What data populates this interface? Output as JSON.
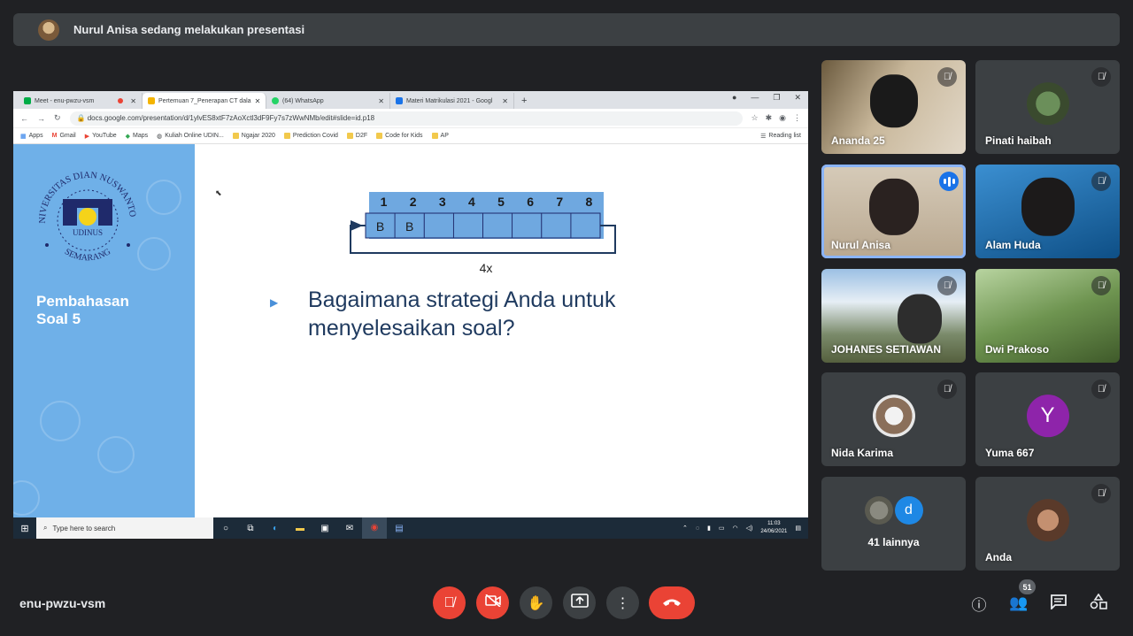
{
  "banner": {
    "text": "Nurul Anisa sedang melakukan presentasi"
  },
  "browser": {
    "tabs": [
      {
        "label": "Meet - enu-pwzu-vsm",
        "color": "#00ac47",
        "active": false
      },
      {
        "label": "Pertemuan 7_Penerapan CT dala",
        "color": "#f4b400",
        "active": true
      },
      {
        "label": "(64) WhatsApp",
        "color": "#25d366",
        "active": false
      },
      {
        "label": "Materi Matrikulasi 2021 - Googl",
        "color": "#1a73e8",
        "active": false
      }
    ],
    "new_tab": "+",
    "url": "docs.google.com/presentation/d/1ylvES8xtF7zAoXctl3dF9Fy7s7zWwNMb/edit#slide=id.p18",
    "bookmarks": [
      "Apps",
      "Gmail",
      "YouTube",
      "Maps",
      "Kuliah Online UDIN...",
      "Ngajar 2020",
      "Prediction Covid",
      "D2F",
      "Code for Kids",
      "AP"
    ],
    "reading_list": "Reading list"
  },
  "slide": {
    "logo_top": "UNIVERSITAS DIAN NUSWANTORO",
    "logo_bottom": "SEMARANG",
    "logo_word": "UDINUS",
    "side_title_line1": "Pembahasan",
    "side_title_line2": "Soal 5",
    "diagram_numbers": [
      "1",
      "2",
      "3",
      "4",
      "5",
      "6",
      "7",
      "8"
    ],
    "diagram_cells": [
      "B",
      "B",
      "",
      "",
      "",
      "",
      "",
      ""
    ],
    "loop_label": "4x",
    "question_line1": "Bagaimana strategi Anda untuk",
    "question_line2": "menyelesaikan soal?"
  },
  "taskbar": {
    "search_placeholder": "Type here to search",
    "time": "11:03",
    "date": "24/06/2021"
  },
  "participants": [
    {
      "name": "Ananda 25",
      "muted": true,
      "bg": "#b9a58c"
    },
    {
      "name": "Pinati haibah",
      "muted": true,
      "bg": "#3c4043"
    },
    {
      "name": "Nurul Anisa",
      "muted": false,
      "bg": "#cbbfae"
    },
    {
      "name": "Alam Huda",
      "muted": true,
      "bg": "#1d6fb0"
    },
    {
      "name": "JOHANES SETIAWAN",
      "muted": true,
      "bg": "#8fb1cf"
    },
    {
      "name": "Dwi Prakoso",
      "muted": true,
      "bg": "#7a9a5a"
    },
    {
      "name": "Nida Karima",
      "muted": true,
      "bg": "#3c4043"
    },
    {
      "name": "Yuma 667",
      "muted": true,
      "bg": "#3c4043",
      "initial": "Y",
      "avatar_color": "#8e24aa"
    },
    {
      "name": "Anda",
      "muted": true,
      "bg": "#3c4043"
    }
  ],
  "others": {
    "label": "41 lainnya",
    "initial": "d",
    "avatar_color": "#1e88e5"
  },
  "meeting": {
    "code": "enu-pwzu-vsm",
    "participant_count": "51"
  }
}
